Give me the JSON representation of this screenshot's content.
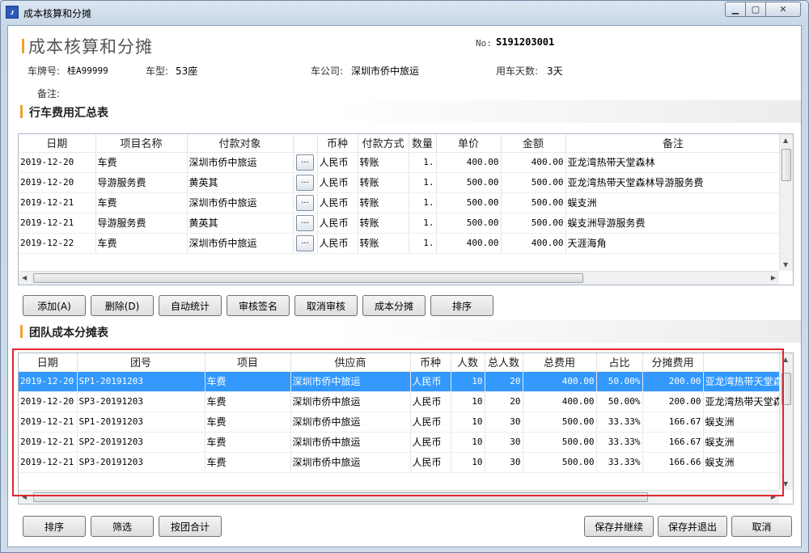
{
  "window": {
    "title": "成本核算和分摊"
  },
  "header": {
    "title": "成本核算和分摊",
    "no_label": "No:",
    "no_value": "S191203001",
    "plate_label": "车牌号:",
    "plate_value": "桂A99999",
    "type_label": "车型:",
    "type_value": "53座",
    "company_label": "车公司:",
    "company_value": "深圳市侨中旅运",
    "days_label": "用车天数:",
    "days_value": "3天",
    "remark_label": "备注:"
  },
  "expense_section": {
    "title": "行车费用汇总表",
    "columns": [
      "日期",
      "项目名称",
      "付款对象",
      "",
      "币种",
      "付款方式",
      "数量",
      "单价",
      "金额",
      "备注"
    ],
    "rows": [
      {
        "date": "2019-12-20",
        "item": "车费",
        "payee": "深圳市侨中旅运",
        "btn": "...",
        "currency": "人民币",
        "method": "转账",
        "qty": "1.",
        "price": "400.00",
        "amount": "400.00",
        "remark": "亚龙湾热带天堂森林"
      },
      {
        "date": "2019-12-20",
        "item": "导游服务费",
        "payee": "黄英其",
        "btn": "...",
        "currency": "人民币",
        "method": "转账",
        "qty": "1.",
        "price": "500.00",
        "amount": "500.00",
        "remark": "亚龙湾热带天堂森林导游服务费"
      },
      {
        "date": "2019-12-21",
        "item": "车费",
        "payee": "深圳市侨中旅运",
        "btn": "...",
        "currency": "人民币",
        "method": "转账",
        "qty": "1.",
        "price": "500.00",
        "amount": "500.00",
        "remark": "蜈支洲"
      },
      {
        "date": "2019-12-21",
        "item": "导游服务费",
        "payee": "黄英其",
        "btn": "...",
        "currency": "人民币",
        "method": "转账",
        "qty": "1.",
        "price": "500.00",
        "amount": "500.00",
        "remark": "蜈支洲导游服务费"
      },
      {
        "date": "2019-12-22",
        "item": "车费",
        "payee": "深圳市侨中旅运",
        "btn": "...",
        "currency": "人民币",
        "method": "转账",
        "qty": "1.",
        "price": "400.00",
        "amount": "400.00",
        "remark": "天涯海角"
      }
    ]
  },
  "toolbar": {
    "add": "添加(A)",
    "delete": "删除(D)",
    "auto_stat": "自动统计",
    "review_sign": "审核签名",
    "cancel_review": "取消审核",
    "cost_allocate": "成本分摊",
    "sort": "排序"
  },
  "allocation_section": {
    "title": "团队成本分摊表",
    "columns": [
      "日期",
      "团号",
      "项目",
      "供应商",
      "币种",
      "人数",
      "总人数",
      "总费用",
      "占比",
      "分摊费用",
      ""
    ],
    "rows": [
      {
        "date": "2019-12-20",
        "group": "SP1-20191203",
        "item": "车费",
        "supplier": "深圳市侨中旅运",
        "currency": "人民币",
        "people": "10",
        "total_people": "20",
        "total_cost": "400.00",
        "ratio": "50.00%",
        "alloc": "200.00",
        "remark": "亚龙湾热带天堂森"
      },
      {
        "date": "2019-12-20",
        "group": "SP3-20191203",
        "item": "车费",
        "supplier": "深圳市侨中旅运",
        "currency": "人民币",
        "people": "10",
        "total_people": "20",
        "total_cost": "400.00",
        "ratio": "50.00%",
        "alloc": "200.00",
        "remark": "亚龙湾热带天堂森"
      },
      {
        "date": "2019-12-21",
        "group": "SP1-20191203",
        "item": "车费",
        "supplier": "深圳市侨中旅运",
        "currency": "人民币",
        "people": "10",
        "total_people": "30",
        "total_cost": "500.00",
        "ratio": "33.33%",
        "alloc": "166.67",
        "remark": "蜈支洲"
      },
      {
        "date": "2019-12-21",
        "group": "SP2-20191203",
        "item": "车费",
        "supplier": "深圳市侨中旅运",
        "currency": "人民币",
        "people": "10",
        "total_people": "30",
        "total_cost": "500.00",
        "ratio": "33.33%",
        "alloc": "166.67",
        "remark": "蜈支洲"
      },
      {
        "date": "2019-12-21",
        "group": "SP3-20191203",
        "item": "车费",
        "supplier": "深圳市侨中旅运",
        "currency": "人民币",
        "people": "10",
        "total_people": "30",
        "total_cost": "500.00",
        "ratio": "33.33%",
        "alloc": "166.66",
        "remark": "蜈支洲"
      }
    ]
  },
  "footer": {
    "sort": "排序",
    "filter": "筛选",
    "group_total": "按团合计",
    "save_continue": "保存并继续",
    "save_exit": "保存并退出",
    "cancel": "取消"
  },
  "colors": {
    "accent": "#f0a030",
    "selection": "#3399ff",
    "highlight_box": "#e0282e"
  }
}
